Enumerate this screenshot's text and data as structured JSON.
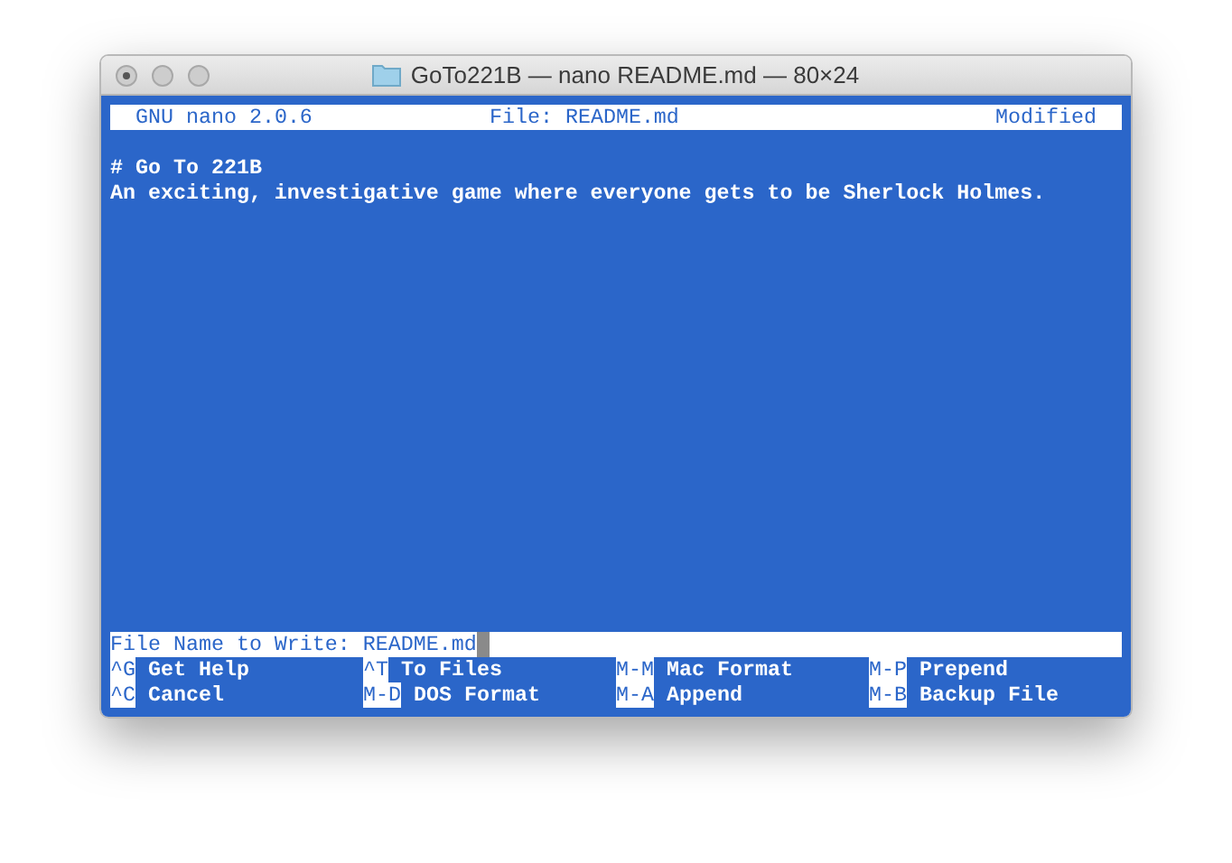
{
  "window": {
    "title": "GoTo221B — nano README.md — 80×24"
  },
  "header": {
    "version": "GNU nano 2.0.6",
    "file": "File: README.md",
    "status": "Modified"
  },
  "lines": [
    "# Go To 221B",
    "An exciting, investigative game where everyone gets to be Sherlock Holmes."
  ],
  "prompt": {
    "label": "File Name to Write: ",
    "value": "README.md"
  },
  "shortcuts": [
    {
      "key": "^G",
      "label": "Get Help"
    },
    {
      "key": "^T",
      "label": "To Files"
    },
    {
      "key": "M-M",
      "label": "Mac Format"
    },
    {
      "key": "M-P",
      "label": "Prepend"
    },
    {
      "key": "^C",
      "label": "Cancel"
    },
    {
      "key": "M-D",
      "label": "DOS Format"
    },
    {
      "key": "M-A",
      "label": "Append"
    },
    {
      "key": "M-B",
      "label": "Backup File"
    }
  ]
}
